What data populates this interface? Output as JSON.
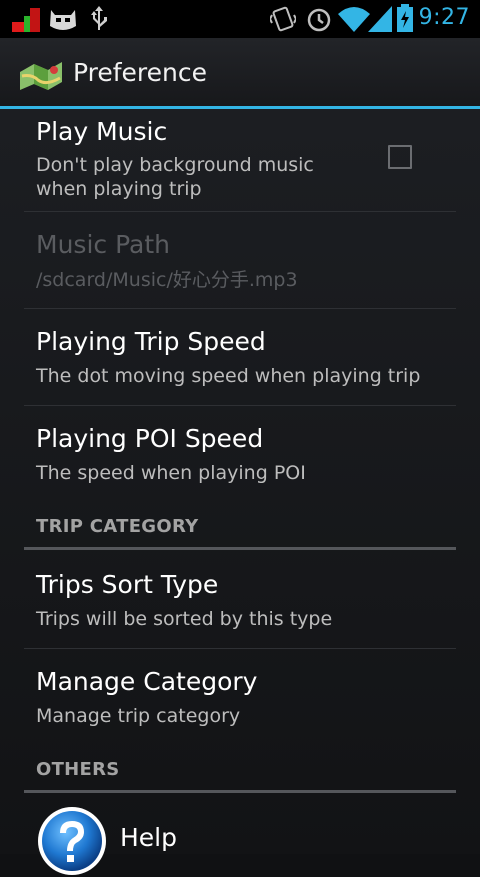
{
  "status_bar": {
    "time": "9:27",
    "icons": [
      "red-green-notification-icon",
      "android-robot-icon",
      "usb-icon",
      "vibrate-icon",
      "alarm-icon",
      "wifi-icon",
      "signal-icon",
      "battery-charging-icon"
    ],
    "accent_color": "#33b5e5"
  },
  "action_bar": {
    "title": "Preference",
    "icon": "map-icon"
  },
  "preferences": {
    "play_music": {
      "title": "Play Music",
      "summary_line1": "Don't play background music",
      "summary_line2": "when playing trip",
      "checked": false
    },
    "music_path": {
      "title": "Music Path",
      "summary": "/sdcard/Music/好心分手.mp3",
      "enabled": false
    },
    "trip_speed": {
      "title": "Playing Trip Speed",
      "summary": "The dot moving speed when playing trip"
    },
    "poi_speed": {
      "title": "Playing POI Speed",
      "summary": "The speed when playing POI"
    },
    "trip_category": {
      "header": "TRIP CATEGORY"
    },
    "sort_type": {
      "title": "Trips Sort Type",
      "summary": "Trips will be sorted by this type"
    },
    "manage_category": {
      "title": "Manage Category",
      "summary": "Manage trip category"
    },
    "others": {
      "header": "OTHERS"
    },
    "help": {
      "title": "Help",
      "icon": "help-question-icon"
    }
  }
}
